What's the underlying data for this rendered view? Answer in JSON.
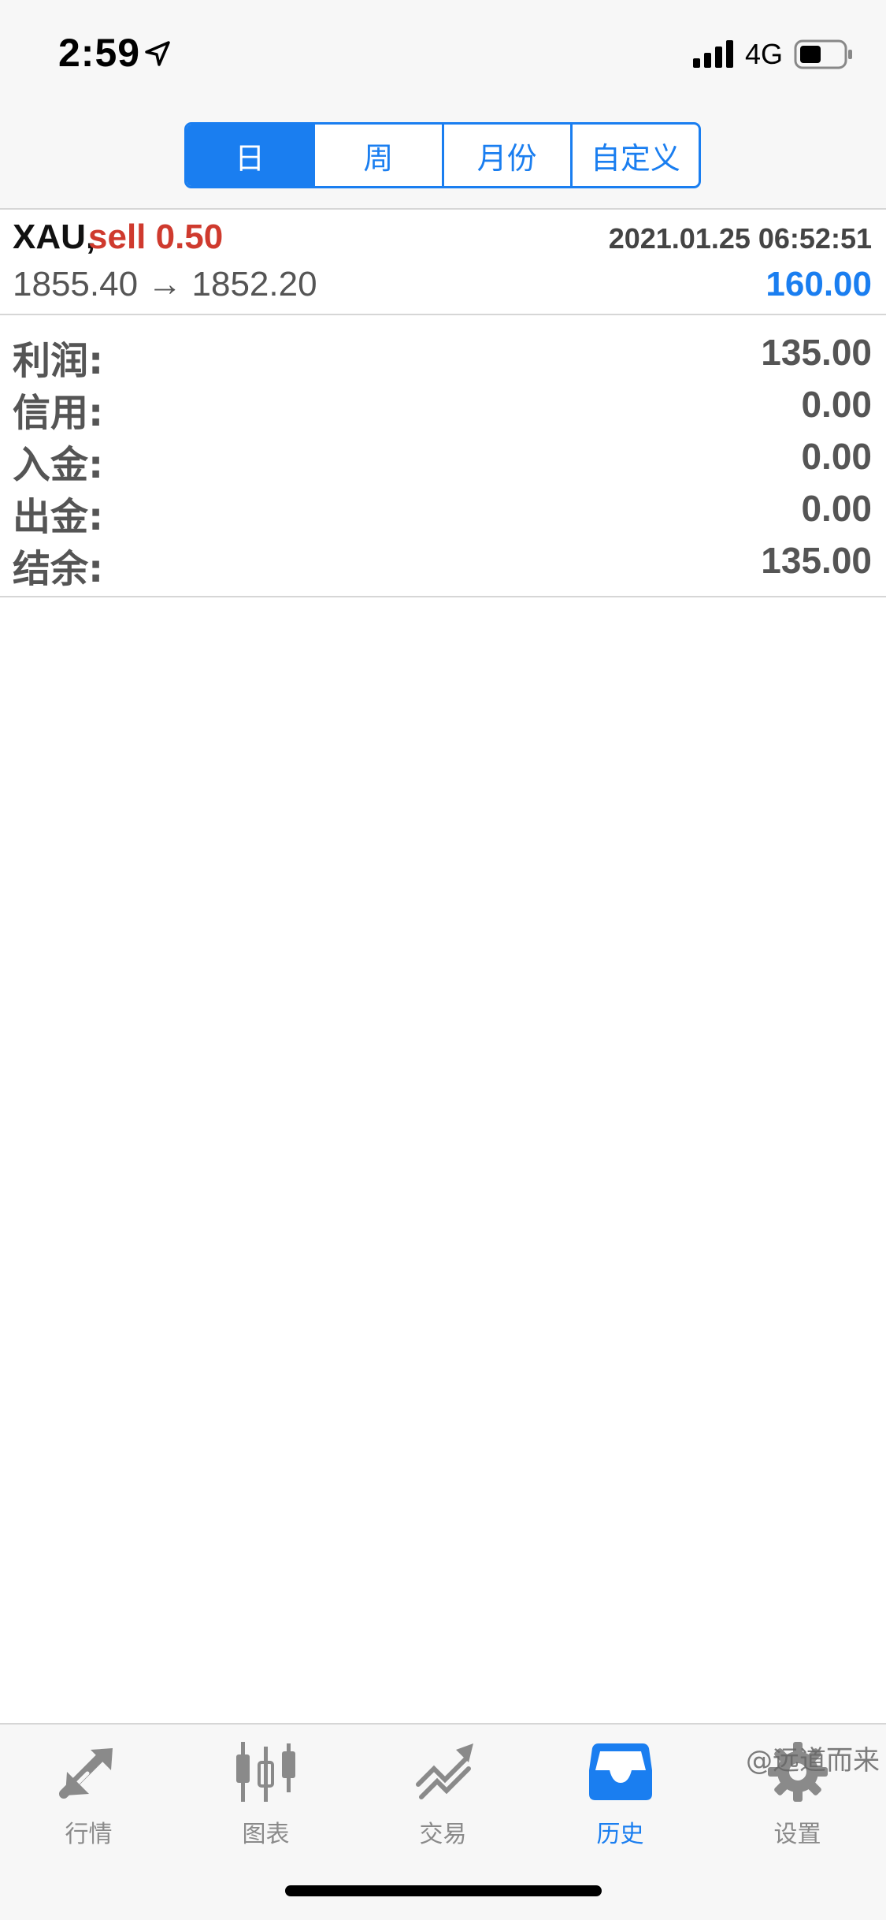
{
  "status_bar": {
    "time": "2:59",
    "network": "4G"
  },
  "period_tabs": [
    {
      "label": "日",
      "active": true
    },
    {
      "label": "周",
      "active": false
    },
    {
      "label": "月份",
      "active": false
    },
    {
      "label": "自定义",
      "active": false
    }
  ],
  "trade": {
    "symbol": "XAU,",
    "side": "sell 0.50",
    "time": "2021.01.25 06:52:51",
    "prices": "1855.40 → 1852.20",
    "profit": "160.00"
  },
  "summary": [
    {
      "label": "利润:",
      "value": "135.00"
    },
    {
      "label": "信用:",
      "value": "0.00"
    },
    {
      "label": "入金:",
      "value": "0.00"
    },
    {
      "label": "出金:",
      "value": "0.00"
    },
    {
      "label": "结余:",
      "value": "135.00"
    }
  ],
  "tabbar": [
    {
      "label": "行情",
      "icon": "quotes-arrows-icon",
      "active": false
    },
    {
      "label": "图表",
      "icon": "candlestick-chart-icon",
      "active": false
    },
    {
      "label": "交易",
      "icon": "trade-trend-icon",
      "active": false
    },
    {
      "label": "历史",
      "icon": "history-inbox-icon",
      "active": true
    },
    {
      "label": "设置",
      "icon": "gear-icon",
      "active": false
    }
  ],
  "watermark": "@远道而来",
  "colors": {
    "accent": "#1a7ef0",
    "sell": "#cf3a2e",
    "inactive": "#8a8a8a"
  }
}
